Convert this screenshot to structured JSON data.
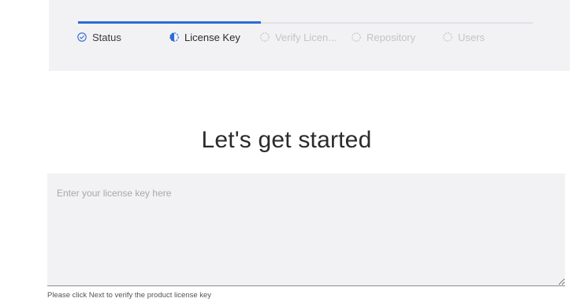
{
  "stepper": {
    "steps": [
      {
        "label": "Status",
        "state": "done"
      },
      {
        "label": "License Key",
        "state": "current"
      },
      {
        "label": "Verify Licen...",
        "state": "pending"
      },
      {
        "label": "Repository",
        "state": "pending"
      },
      {
        "label": "Users",
        "state": "pending"
      }
    ]
  },
  "main": {
    "heading": "Let's get started",
    "license_input": {
      "placeholder": "Enter your license key here",
      "value": ""
    },
    "helper_text": "Please click Next to verify the product license key"
  },
  "colors": {
    "accent": "#2e6ad8",
    "band_background": "#f2f2f4",
    "pending_text": "#c4c4c8"
  }
}
